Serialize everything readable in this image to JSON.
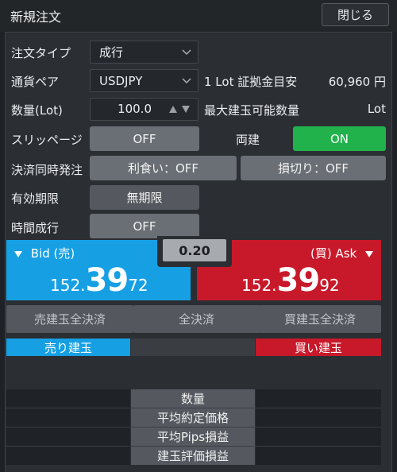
{
  "window": {
    "title": "新規注文",
    "close_label": "閉じる"
  },
  "form": {
    "order_type": {
      "label": "注文タイプ",
      "value": "成行"
    },
    "currency_pair": {
      "label": "通貨ペア",
      "value": "USDJPY"
    },
    "margin": {
      "label": "1 Lot 証拠金目安",
      "value": "60,960 円"
    },
    "quantity": {
      "label": "数量(Lot)",
      "value": "100.0"
    },
    "max_quantity": {
      "label": "最大建玉可能数量",
      "value": "Lot"
    },
    "slippage": {
      "label": "スリッページ",
      "value": "OFF"
    },
    "hedge": {
      "label": "両建",
      "value": "ON"
    },
    "settlement": {
      "label": "決済同時発注",
      "take_profit": "利食い：OFF",
      "stop_loss": "損切り：OFF"
    },
    "expiry": {
      "label": "有効期限",
      "value": "無期限"
    },
    "time_market": {
      "label": "時間成行",
      "value": "OFF"
    }
  },
  "quote": {
    "bid": {
      "label": "Bid (売)",
      "prefix": "152.",
      "big": "39",
      "suffix": "72"
    },
    "ask": {
      "label": "(買) Ask",
      "prefix": "152.",
      "big": "39",
      "suffix": "92"
    },
    "spread": "0.20"
  },
  "actions": {
    "sell_close_all": "売建玉全決済",
    "close_all": "全決済",
    "buy_close_all": "買建玉全決済"
  },
  "positions": {
    "sell_header": "売り建玉",
    "buy_header": "買い建玉",
    "rows": [
      "数量",
      "平均約定価格",
      "平均Pips損益",
      "建玉評価損益"
    ]
  },
  "colors": {
    "bid": "#16a0e3",
    "ask": "#c8192a",
    "on": "#21b24c",
    "button": "#6a6e75"
  }
}
